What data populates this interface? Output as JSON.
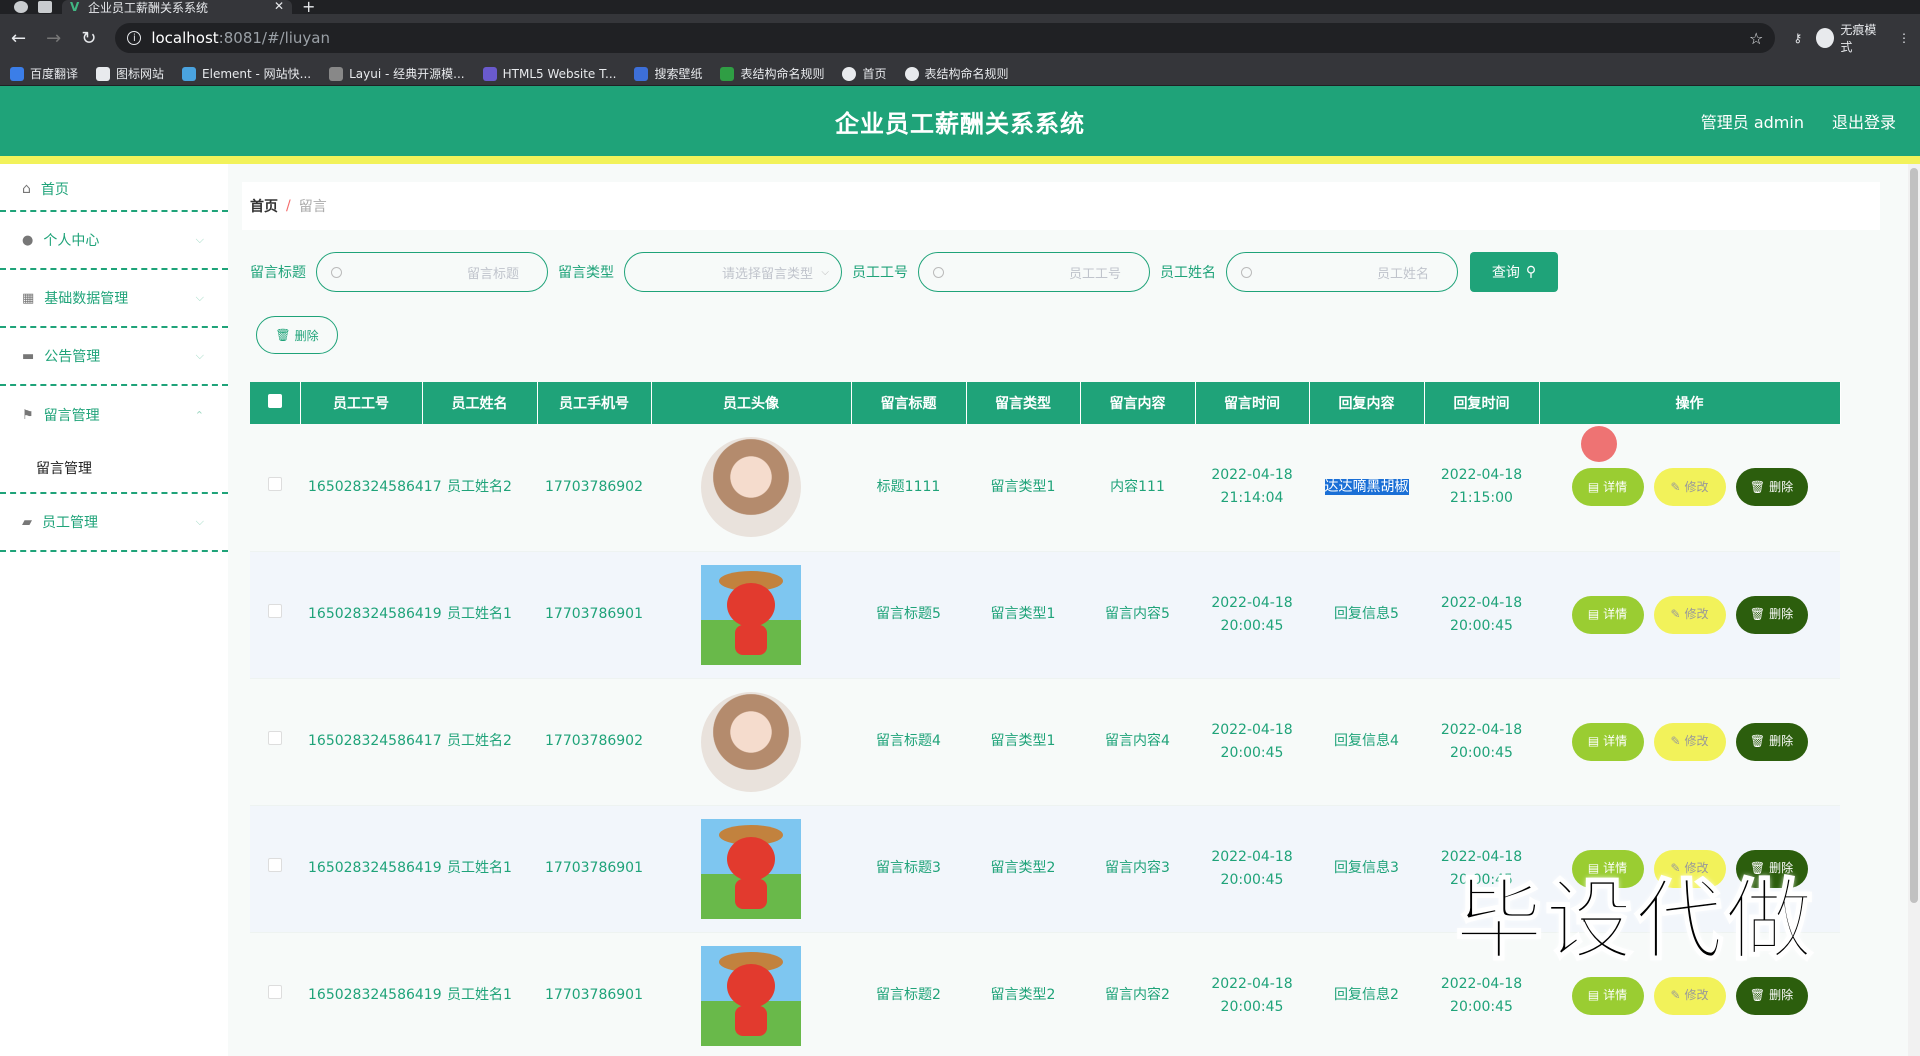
{
  "browser": {
    "tab_title": "企业员工薪酬关系系统",
    "url_host": "localhost",
    "url_path": ":8081/#/liuyan",
    "incognito_label": "无痕模式",
    "bookmarks": [
      "百度翻译",
      "图标网站",
      "Element - 网站快...",
      "Layui - 经典开源模...",
      "HTML5 Website T...",
      "搜索壁纸",
      "表结构命名规则",
      "首页",
      "表结构命名规则"
    ]
  },
  "header": {
    "title": "企业员工薪酬关系系统",
    "user": "管理员 admin",
    "logout": "退出登录"
  },
  "sidebar": {
    "items": [
      {
        "label": "首页"
      },
      {
        "label": "个人中心"
      },
      {
        "label": "基础数据管理"
      },
      {
        "label": "公告管理"
      },
      {
        "label": "留言管理"
      },
      {
        "label": "留言管理"
      },
      {
        "label": "员工管理"
      }
    ]
  },
  "breadcrumb": {
    "home": "首页",
    "sep": "/",
    "current": "留言"
  },
  "search": {
    "title_label": "留言标题",
    "title_ph": "留言标题",
    "type_label": "留言类型",
    "type_ph": "请选择留言类型",
    "no_label": "员工工号",
    "no_ph": "员工工号",
    "name_label": "员工姓名",
    "name_ph": "员工姓名",
    "query_btn": "查询",
    "delete_btn": "删除"
  },
  "table": {
    "headers": [
      "员工工号",
      "员工姓名",
      "员工手机号",
      "员工头像",
      "留言标题",
      "留言类型",
      "留言内容",
      "留言时间",
      "回复内容",
      "回复时间",
      "操作"
    ],
    "actions": {
      "detail": "详情",
      "edit": "修改",
      "delete": "删除"
    },
    "rows": [
      {
        "no": "165028324586417",
        "name": "员工姓名2",
        "phone": "17703786902",
        "avatar": "girl",
        "title": "标题1111",
        "type": "留言类型1",
        "content": "内容111",
        "time": "2022-04-18 21:14:04",
        "reply": "达达嘀黑胡椒",
        "reply_time": "2022-04-18 21:15:00"
      },
      {
        "no": "165028324586419",
        "name": "员工姓名1",
        "phone": "17703786901",
        "avatar": "cartoon",
        "title": "留言标题5",
        "type": "留言类型1",
        "content": "留言内容5",
        "time": "2022-04-18 20:00:45",
        "reply": "回复信息5",
        "reply_time": "2022-04-18 20:00:45"
      },
      {
        "no": "165028324586417",
        "name": "员工姓名2",
        "phone": "17703786902",
        "avatar": "girl",
        "title": "留言标题4",
        "type": "留言类型1",
        "content": "留言内容4",
        "time": "2022-04-18 20:00:45",
        "reply": "回复信息4",
        "reply_time": "2022-04-18 20:00:45"
      },
      {
        "no": "165028324586419",
        "name": "员工姓名1",
        "phone": "17703786901",
        "avatar": "cartoon",
        "title": "留言标题3",
        "type": "留言类型2",
        "content": "留言内容3",
        "time": "2022-04-18 20:00:45",
        "reply": "回复信息3",
        "reply_time": "2022-04-18 20:00:45"
      },
      {
        "no": "165028324586419",
        "name": "员工姓名1",
        "phone": "17703786901",
        "avatar": "cartoon",
        "title": "留言标题2",
        "type": "留言类型2",
        "content": "留言内容2",
        "time": "2022-04-18 20:00:45",
        "reply": "回复信息2",
        "reply_time": "2022-04-18 20:00:45"
      }
    ]
  },
  "watermark": "毕设代做"
}
